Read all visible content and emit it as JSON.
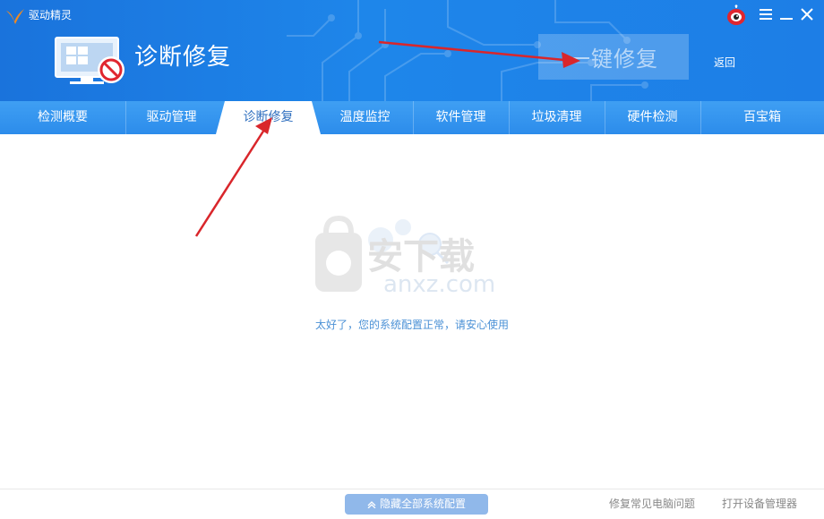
{
  "app": {
    "title": "驱动精灵"
  },
  "header": {
    "page_title": "诊断修复",
    "repair_button": "一键修复",
    "back_label": "返回"
  },
  "tabs": [
    {
      "label": "检测概要",
      "active": false
    },
    {
      "label": "驱动管理",
      "active": false
    },
    {
      "label": "诊断修复",
      "active": true
    },
    {
      "label": "温度监控",
      "active": false
    },
    {
      "label": "软件管理",
      "active": false
    },
    {
      "label": "垃圾清理",
      "active": false
    },
    {
      "label": "硬件检测",
      "active": false
    },
    {
      "label": "百宝箱",
      "active": false
    }
  ],
  "main": {
    "status_message": "太好了，您的系统配置正常，请安心使用",
    "watermark_text": "安下载",
    "watermark_domain": "anxz.com"
  },
  "footer": {
    "hide_button": "隐藏全部系统配置",
    "fix_common_link": "修复常见电脑问题",
    "device_manager_link": "打开设备管理器"
  },
  "icons": {
    "logo": "bird-logo-icon",
    "robot": "robot-mascot-icon",
    "menu": "menu-icon",
    "minimize": "minimize-icon",
    "close": "close-icon",
    "monitor": "monitor-repair-icon"
  },
  "colors": {
    "header_blue": "#1e86ea",
    "tab_blue": "#3f9ff3",
    "active_tab_text": "#2f6fbf",
    "status_text": "#4b91d6",
    "arrow_red": "#d9262b"
  }
}
